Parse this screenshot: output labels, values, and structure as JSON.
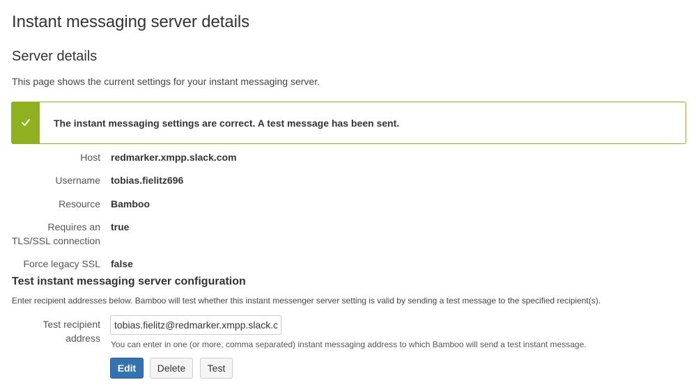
{
  "page": {
    "title": "Instant messaging server details",
    "section_title": "Server details",
    "intro": "This page shows the current settings for your instant messaging server."
  },
  "success": {
    "message": "The instant messaging settings are correct. A test message has been sent.",
    "color": "#8eb021",
    "icon": "check-icon"
  },
  "details": [
    {
      "label": "Host",
      "value": "redmarker.xmpp.slack.com"
    },
    {
      "label": "Username",
      "value": "tobias.fielitz696"
    },
    {
      "label": "Resource",
      "value": "Bamboo"
    },
    {
      "label_line1": "Requires an",
      "label_line2": "TLS/SSL connection",
      "value": "true"
    },
    {
      "label": "Force legacy SSL",
      "value": "false"
    }
  ],
  "test": {
    "title": "Test instant messaging server configuration",
    "description": "Enter recipient addresses below. Bamboo will test whether this instant messenger server setting is valid by sending a test message to the specified recipient(s).",
    "recipient_label_line1": "Test recipient",
    "recipient_label_line2": "address",
    "recipient_value": "tobias.fielitz@redmarker.xmpp.slack.com",
    "help": "You can enter in one (or more, comma separated) instant messaging address to which Bamboo will send a test instant message."
  },
  "buttons": {
    "edit": "Edit",
    "delete": "Delete",
    "test": "Test",
    "primary_color": "#3572b0"
  }
}
